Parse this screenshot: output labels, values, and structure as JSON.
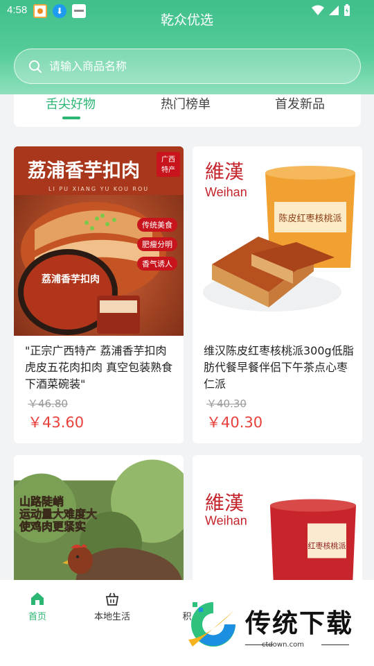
{
  "status": {
    "time": "4:58",
    "download_glyph": "⬇"
  },
  "header": {
    "title": "乾众优选"
  },
  "search": {
    "placeholder": "请输入商品名称"
  },
  "tabs": [
    {
      "label": "舌尖好物",
      "active": true
    },
    {
      "label": "热门榜单",
      "active": false
    },
    {
      "label": "首发新品",
      "active": false
    }
  ],
  "products": [
    {
      "name": "\"正宗广西特产 荔浦香芋扣肉虎皮五花肉扣肉 真空包装熟食下酒菜碗装\"",
      "old_price": "￥46.80",
      "price": "￥43.60",
      "image_text": {
        "headline": "荔浦香芋扣肉",
        "pinyin": "LI PU XIANG YU KOU ROU",
        "badge": "广西\n特产",
        "tags": [
          "传统美食",
          "肥瘦分明",
          "香气诱人"
        ],
        "package": "荔浦香芋扣肉"
      }
    },
    {
      "name": "维汉陈皮红枣核桃派300g低脂肪代餐早餐伴侣下午茶点心枣仁派",
      "old_price": "￥40.30",
      "price": "￥40.30",
      "image_text": {
        "brand_cn": "維漢",
        "brand_en": "Weihan",
        "package": "陈皮红枣核桃派"
      }
    },
    {
      "name": "",
      "image_text": {
        "lines": [
          "山路陡峭",
          "运动量大难度大",
          "使鸡肉更紧实"
        ]
      }
    },
    {
      "name": "",
      "image_text": {
        "brand_cn": "維漢",
        "brand_en": "Weihan",
        "package": "红枣核桃派"
      }
    }
  ],
  "bottom_nav": [
    {
      "label": "首页",
      "active": true
    },
    {
      "label": "本地生活",
      "active": false
    },
    {
      "label": "积",
      "active": false
    }
  ],
  "watermark": {
    "text": "传统下载",
    "url": "ctdown.com"
  },
  "colors": {
    "accent": "#2bb673",
    "price": "#e8413c",
    "header_top": "#3fbf8a"
  }
}
